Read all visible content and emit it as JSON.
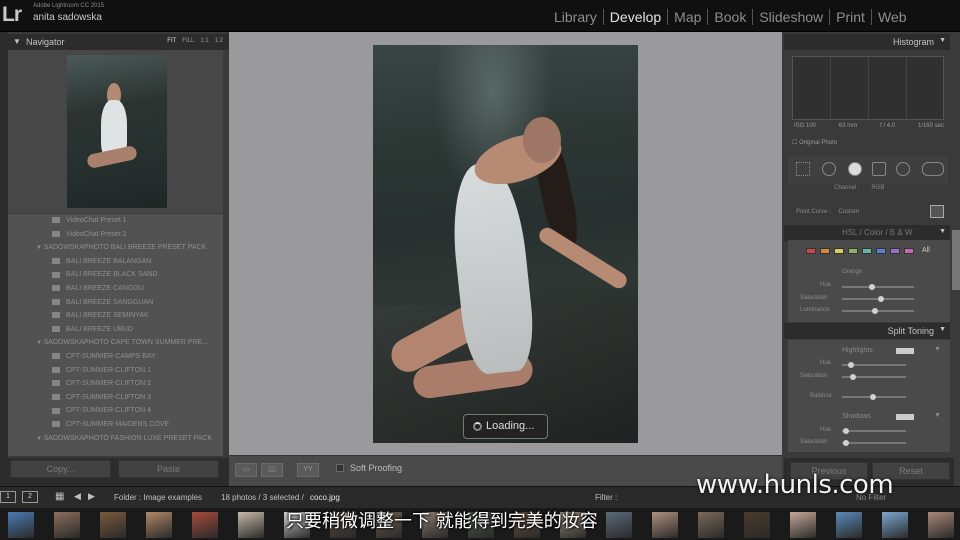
{
  "app": {
    "name": "Adobe Lightroom CC 2015",
    "logo": "Lr",
    "user": "anita sadowska"
  },
  "modules": [
    {
      "label": "Library",
      "active": false
    },
    {
      "label": "Develop",
      "active": true
    },
    {
      "label": "Map",
      "active": false
    },
    {
      "label": "Book",
      "active": false
    },
    {
      "label": "Slideshow",
      "active": false
    },
    {
      "label": "Print",
      "active": false
    },
    {
      "label": "Web",
      "active": false
    }
  ],
  "navigator": {
    "title": "Navigator",
    "zoom_options": [
      "FIT",
      "FILL",
      "1:1",
      "1:2"
    ]
  },
  "presets": {
    "items": [
      {
        "label": "VideoChat Preset 1",
        "parent": false
      },
      {
        "label": "VideoChat Preset 2",
        "parent": false
      },
      {
        "label": "SADOWSKAPHOTO BALI BREEZE PRESET PACK",
        "parent": true
      },
      {
        "label": "BALI BREEZE BALANGAN",
        "parent": false
      },
      {
        "label": "BALI BREEZE BLACK SAND",
        "parent": false
      },
      {
        "label": "BALI BREEZE CANGGU",
        "parent": false
      },
      {
        "label": "BALI BREEZE SANGGUAN",
        "parent": false
      },
      {
        "label": "BALI BREEZE SEMINYAK",
        "parent": false
      },
      {
        "label": "BALI BREEZE UBUD",
        "parent": false
      },
      {
        "label": "SADOWSKAPHOTO CAPE TOWN SUMMER PRE...",
        "parent": true
      },
      {
        "label": "CPT-SUMMER-CAMPS BAY",
        "parent": false
      },
      {
        "label": "CPT-SUMMER-CLIFTON 1",
        "parent": false
      },
      {
        "label": "CPT-SUMMER-CLIFTON 2",
        "parent": false
      },
      {
        "label": "CPT-SUMMER-CLIFTON 3",
        "parent": false
      },
      {
        "label": "CPT-SUMMER-CLIFTON 4",
        "parent": false
      },
      {
        "label": "CPT-SUMMER-MAIDENS COVE",
        "parent": false
      },
      {
        "label": "SADOWSKAPHOTO FASHION LUXE PRESET PACK",
        "parent": true
      }
    ]
  },
  "left_footer": {
    "copy": "Copy...",
    "paste": "Paste"
  },
  "loading": {
    "label": "Loading..."
  },
  "toolbar": {
    "soft_proofing": "Soft Proofing"
  },
  "right_panel": {
    "histogram": "Histogram",
    "exif": {
      "iso": "ISO 100",
      "focal": "63 mm",
      "aperture": "f / 4.0",
      "shutter": "1/160 sec"
    },
    "original_photo": "Original Photo",
    "channel_label": "Channel :",
    "channel_value": "RGB",
    "point_curve_label": "Point Curve :",
    "point_curve_value": "Custom",
    "hsl_tabs": [
      "HSL",
      "/",
      "Color",
      "/",
      "B & W"
    ],
    "hsl_all": "All",
    "hsl_group": "Orange",
    "hsl_sliders": [
      "Hue",
      "Saturation",
      "Luminance"
    ],
    "split_toning": "Split Toning",
    "highlights": "Highlights",
    "shadows": "Shadows",
    "split_hl_sliders": [
      "Hue",
      "Saturation"
    ],
    "balance": "Balance",
    "split_sh_sliders": [
      "Hue",
      "Saturation"
    ],
    "previous": "Previous",
    "reset": "Reset",
    "swatch_colors": [
      "#c9494b",
      "#d8883e",
      "#d7cf5a",
      "#86b75f",
      "#5fb8a9",
      "#5b7fd0",
      "#9a6bc9",
      "#c667b1"
    ]
  },
  "filmbar": {
    "view1": "1",
    "view2": "2",
    "folder": "Folder : Image examples",
    "count": "18 photos / 3 selected /",
    "filename": "coco.jpg",
    "filter_label": "Filter :",
    "filter_value": "No Filter"
  },
  "watermark": "www.hunls.com",
  "subtitle": "只要稍微调整一下 就能得到完美的妆容",
  "filmstrip_colors": [
    "#4a7bb3",
    "#8c6e5c",
    "#7a5a3c",
    "#b08868",
    "#a84a3c",
    "#c8b8a8",
    "#d0d0d0",
    "#5a4a3a",
    "#6a5a4a",
    "#8a7a6a",
    "#4a5a4a",
    "#6a4a3a",
    "#9a8a7a",
    "#5a6a7a",
    "#b09080",
    "#7a6a5a",
    "#4a3a2a",
    "#c8a898",
    "#5a8ab8",
    "#7aa8d0",
    "#a88878",
    "#384848"
  ]
}
